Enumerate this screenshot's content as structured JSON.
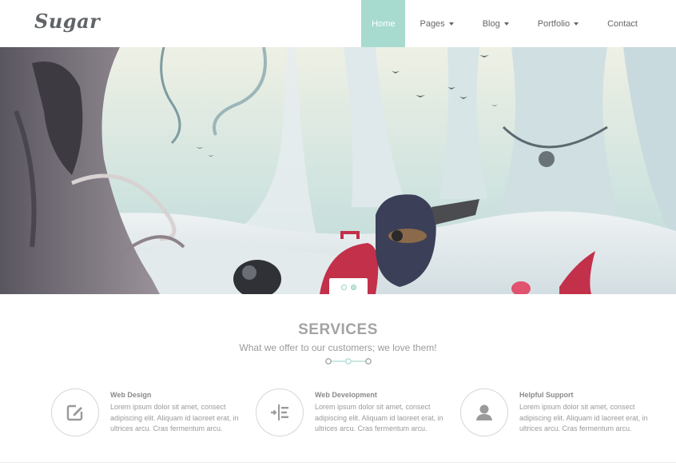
{
  "brand": {
    "logo": "Sugar"
  },
  "nav": {
    "items": [
      {
        "label": "Home",
        "active": true,
        "dropdown": false
      },
      {
        "label": "Pages",
        "active": false,
        "dropdown": true
      },
      {
        "label": "Blog",
        "active": false,
        "dropdown": true
      },
      {
        "label": "Portfolio",
        "active": false,
        "dropdown": true
      },
      {
        "label": "Contact",
        "active": false,
        "dropdown": false
      }
    ]
  },
  "slider": {
    "slides": 2,
    "current": 2
  },
  "services": {
    "title": "SERVICES",
    "subtitle": "What we offer to our customers; we love them!",
    "items": [
      {
        "icon": "edit-icon",
        "title": "Web Design",
        "desc": "Lorem ipsum dolor sit amet, consect adipiscing elit. Aliquam id laoreet erat, in ultrices arcu. Cras fermentum arcu."
      },
      {
        "icon": "align-icon",
        "title": "Web Development",
        "desc": "Lorem ipsum dolor sit amet, consect adipiscing elit. Aliquam id laoreet erat, in ultrices arcu. Cras fermentum arcu."
      },
      {
        "icon": "user-icon",
        "title": "Helpful Support",
        "desc": "Lorem ipsum dolor sit amet, consect adipiscing elit. Aliquam id laoreet erat, in ultrices arcu. Cras fermentum arcu."
      }
    ]
  },
  "colors": {
    "accent": "#a8dbcf",
    "text": "#666666",
    "muted": "#9a9a9a"
  }
}
